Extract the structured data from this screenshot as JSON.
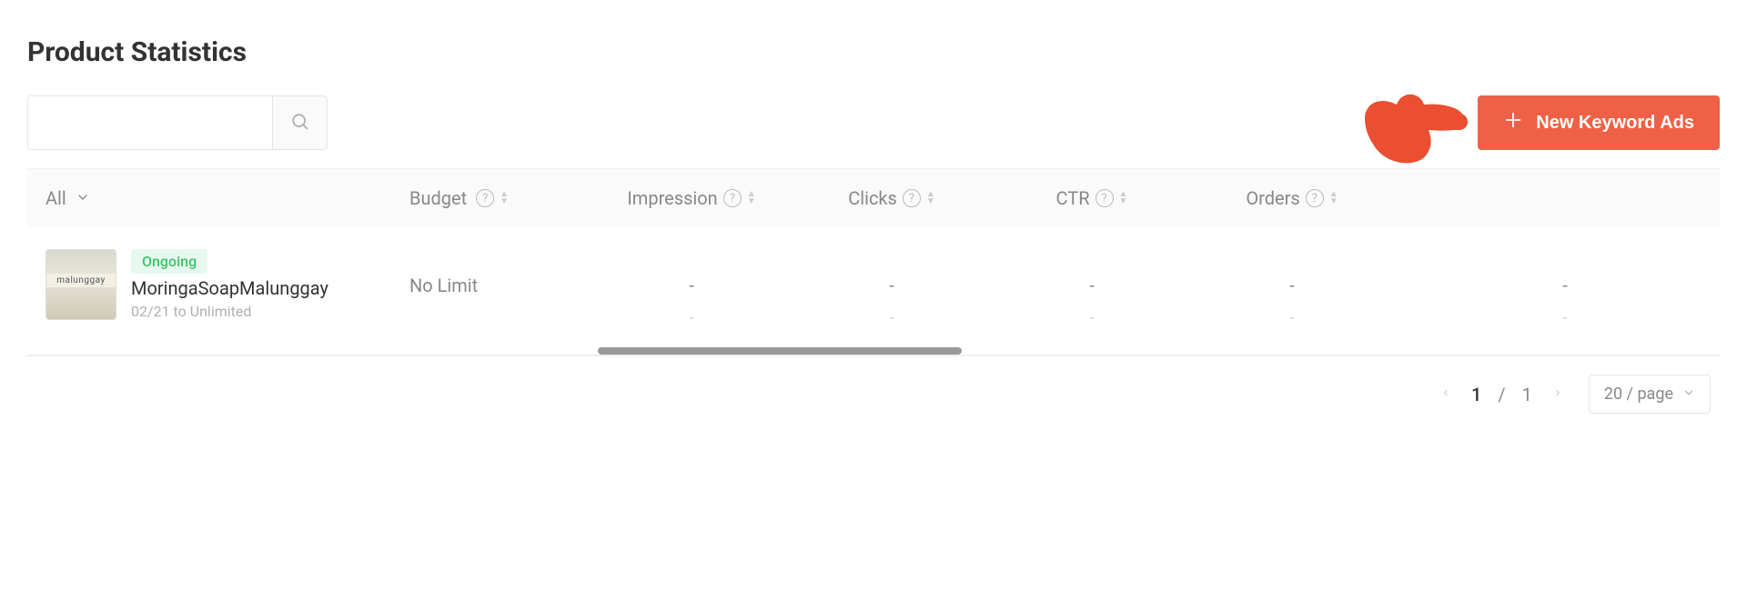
{
  "title": "Product Statistics",
  "search": {
    "placeholder": ""
  },
  "actions": {
    "new_keyword_ads": "New Keyword Ads"
  },
  "columns": {
    "filter_label": "All",
    "budget": "Budget",
    "impression": "Impression",
    "clicks": "Clicks",
    "ctr": "CTR",
    "orders": "Orders"
  },
  "rows": [
    {
      "status": "Ongoing",
      "name": "MoringaSoapMalunggay",
      "dates": "02/21 to Unlimited",
      "budget": "No Limit",
      "impression": "-",
      "impression_sub": "-",
      "clicks": "-",
      "clicks_sub": "-",
      "ctr": "-",
      "ctr_sub": "-",
      "orders": "-",
      "orders_sub": "-"
    }
  ],
  "pagination": {
    "current": "1",
    "sep": "/",
    "total": "1",
    "page_size_label": "20 / page"
  }
}
